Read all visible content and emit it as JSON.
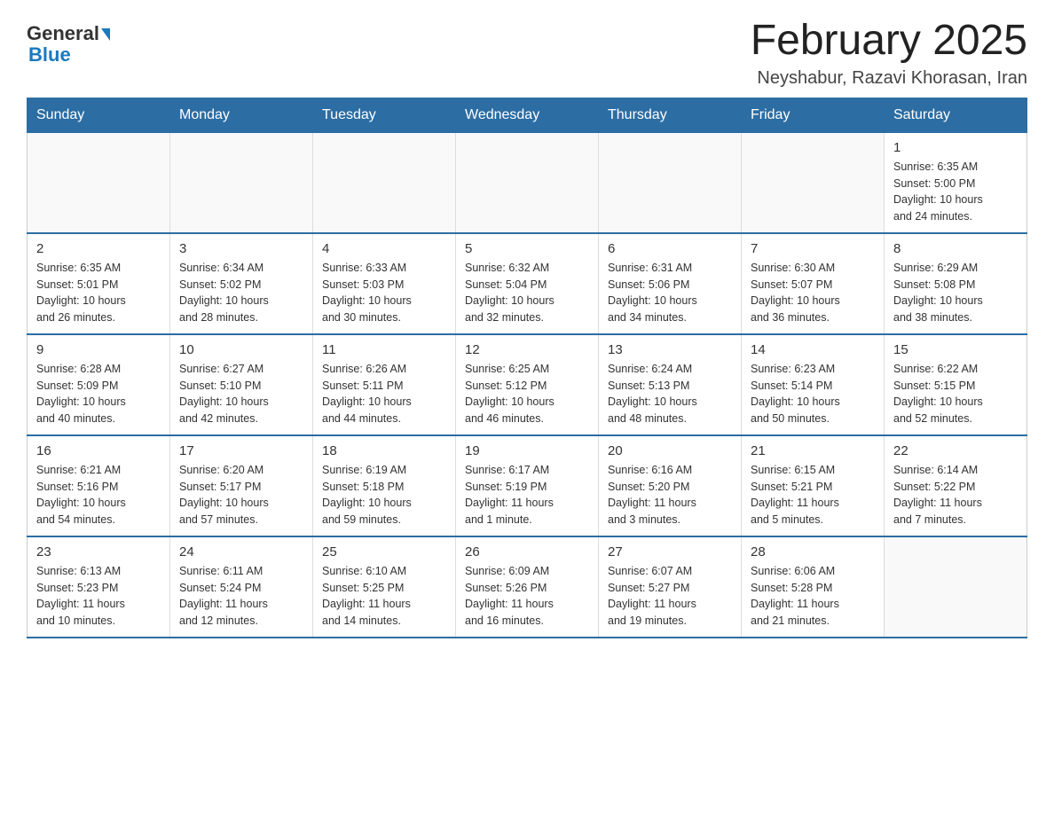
{
  "header": {
    "logo_general": "General",
    "logo_blue": "Blue",
    "title": "February 2025",
    "location": "Neyshabur, Razavi Khorasan, Iran"
  },
  "calendar": {
    "weekdays": [
      "Sunday",
      "Monday",
      "Tuesday",
      "Wednesday",
      "Thursday",
      "Friday",
      "Saturday"
    ],
    "weeks": [
      [
        {
          "day": "",
          "info": ""
        },
        {
          "day": "",
          "info": ""
        },
        {
          "day": "",
          "info": ""
        },
        {
          "day": "",
          "info": ""
        },
        {
          "day": "",
          "info": ""
        },
        {
          "day": "",
          "info": ""
        },
        {
          "day": "1",
          "info": "Sunrise: 6:35 AM\nSunset: 5:00 PM\nDaylight: 10 hours\nand 24 minutes."
        }
      ],
      [
        {
          "day": "2",
          "info": "Sunrise: 6:35 AM\nSunset: 5:01 PM\nDaylight: 10 hours\nand 26 minutes."
        },
        {
          "day": "3",
          "info": "Sunrise: 6:34 AM\nSunset: 5:02 PM\nDaylight: 10 hours\nand 28 minutes."
        },
        {
          "day": "4",
          "info": "Sunrise: 6:33 AM\nSunset: 5:03 PM\nDaylight: 10 hours\nand 30 minutes."
        },
        {
          "day": "5",
          "info": "Sunrise: 6:32 AM\nSunset: 5:04 PM\nDaylight: 10 hours\nand 32 minutes."
        },
        {
          "day": "6",
          "info": "Sunrise: 6:31 AM\nSunset: 5:06 PM\nDaylight: 10 hours\nand 34 minutes."
        },
        {
          "day": "7",
          "info": "Sunrise: 6:30 AM\nSunset: 5:07 PM\nDaylight: 10 hours\nand 36 minutes."
        },
        {
          "day": "8",
          "info": "Sunrise: 6:29 AM\nSunset: 5:08 PM\nDaylight: 10 hours\nand 38 minutes."
        }
      ],
      [
        {
          "day": "9",
          "info": "Sunrise: 6:28 AM\nSunset: 5:09 PM\nDaylight: 10 hours\nand 40 minutes."
        },
        {
          "day": "10",
          "info": "Sunrise: 6:27 AM\nSunset: 5:10 PM\nDaylight: 10 hours\nand 42 minutes."
        },
        {
          "day": "11",
          "info": "Sunrise: 6:26 AM\nSunset: 5:11 PM\nDaylight: 10 hours\nand 44 minutes."
        },
        {
          "day": "12",
          "info": "Sunrise: 6:25 AM\nSunset: 5:12 PM\nDaylight: 10 hours\nand 46 minutes."
        },
        {
          "day": "13",
          "info": "Sunrise: 6:24 AM\nSunset: 5:13 PM\nDaylight: 10 hours\nand 48 minutes."
        },
        {
          "day": "14",
          "info": "Sunrise: 6:23 AM\nSunset: 5:14 PM\nDaylight: 10 hours\nand 50 minutes."
        },
        {
          "day": "15",
          "info": "Sunrise: 6:22 AM\nSunset: 5:15 PM\nDaylight: 10 hours\nand 52 minutes."
        }
      ],
      [
        {
          "day": "16",
          "info": "Sunrise: 6:21 AM\nSunset: 5:16 PM\nDaylight: 10 hours\nand 54 minutes."
        },
        {
          "day": "17",
          "info": "Sunrise: 6:20 AM\nSunset: 5:17 PM\nDaylight: 10 hours\nand 57 minutes."
        },
        {
          "day": "18",
          "info": "Sunrise: 6:19 AM\nSunset: 5:18 PM\nDaylight: 10 hours\nand 59 minutes."
        },
        {
          "day": "19",
          "info": "Sunrise: 6:17 AM\nSunset: 5:19 PM\nDaylight: 11 hours\nand 1 minute."
        },
        {
          "day": "20",
          "info": "Sunrise: 6:16 AM\nSunset: 5:20 PM\nDaylight: 11 hours\nand 3 minutes."
        },
        {
          "day": "21",
          "info": "Sunrise: 6:15 AM\nSunset: 5:21 PM\nDaylight: 11 hours\nand 5 minutes."
        },
        {
          "day": "22",
          "info": "Sunrise: 6:14 AM\nSunset: 5:22 PM\nDaylight: 11 hours\nand 7 minutes."
        }
      ],
      [
        {
          "day": "23",
          "info": "Sunrise: 6:13 AM\nSunset: 5:23 PM\nDaylight: 11 hours\nand 10 minutes."
        },
        {
          "day": "24",
          "info": "Sunrise: 6:11 AM\nSunset: 5:24 PM\nDaylight: 11 hours\nand 12 minutes."
        },
        {
          "day": "25",
          "info": "Sunrise: 6:10 AM\nSunset: 5:25 PM\nDaylight: 11 hours\nand 14 minutes."
        },
        {
          "day": "26",
          "info": "Sunrise: 6:09 AM\nSunset: 5:26 PM\nDaylight: 11 hours\nand 16 minutes."
        },
        {
          "day": "27",
          "info": "Sunrise: 6:07 AM\nSunset: 5:27 PM\nDaylight: 11 hours\nand 19 minutes."
        },
        {
          "day": "28",
          "info": "Sunrise: 6:06 AM\nSunset: 5:28 PM\nDaylight: 11 hours\nand 21 minutes."
        },
        {
          "day": "",
          "info": ""
        }
      ]
    ]
  }
}
